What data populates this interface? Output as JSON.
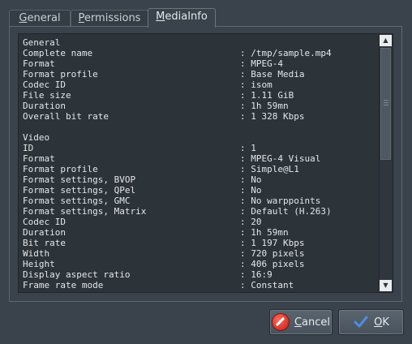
{
  "tabs": [
    {
      "label_pre": "",
      "label_ul": "G",
      "label_post": "eneral"
    },
    {
      "label_pre": "",
      "label_ul": "P",
      "label_post": "ermissions"
    },
    {
      "label_pre": "",
      "label_ul": "M",
      "label_post": "ediaInfo"
    }
  ],
  "sections": [
    {
      "rows": [
        {
          "k": "General",
          "v": ""
        },
        {
          "k": "Complete name",
          "v": ": /tmp/sample.mp4"
        },
        {
          "k": "Format",
          "v": ": MPEG-4"
        },
        {
          "k": "Format profile",
          "v": ": Base Media"
        },
        {
          "k": "Codec ID",
          "v": ": isom"
        },
        {
          "k": "File size",
          "v": ": 1.11 GiB"
        },
        {
          "k": "Duration",
          "v": ": 1h 59mn"
        },
        {
          "k": "Overall bit rate",
          "v": ": 1 328 Kbps"
        }
      ]
    },
    {
      "rows": [
        {
          "k": "Video",
          "v": ""
        },
        {
          "k": "ID",
          "v": ": 1"
        },
        {
          "k": "Format",
          "v": ": MPEG-4 Visual"
        },
        {
          "k": "Format profile",
          "v": ": Simple@L1"
        },
        {
          "k": "Format settings, BVOP",
          "v": ": No"
        },
        {
          "k": "Format settings, QPel",
          "v": ": No"
        },
        {
          "k": "Format settings, GMC",
          "v": ": No warppoints"
        },
        {
          "k": "Format settings, Matrix",
          "v": ": Default (H.263)"
        },
        {
          "k": "Codec ID",
          "v": ": 20"
        },
        {
          "k": "Duration",
          "v": ": 1h 59mn"
        },
        {
          "k": "Bit rate",
          "v": ": 1 197 Kbps"
        },
        {
          "k": "Width",
          "v": ": 720 pixels"
        },
        {
          "k": "Height",
          "v": ": 406 pixels"
        },
        {
          "k": "Display aspect ratio",
          "v": ": 16:9"
        },
        {
          "k": "Frame rate mode",
          "v": ": Constant"
        }
      ]
    }
  ],
  "scrollbar": {
    "up_icon": "arrow-up",
    "down_icon": "arrow-down",
    "position": 0
  },
  "buttons": {
    "cancel": {
      "pre": "",
      "ul": "C",
      "post": "ancel",
      "icon": "cancel-icon"
    },
    "ok": {
      "pre": "",
      "ul": "O",
      "post": "K",
      "icon": "checkmark-icon"
    }
  },
  "colors": {
    "accent": "#3b7fd1",
    "cancel_icon": "#d8261c"
  }
}
